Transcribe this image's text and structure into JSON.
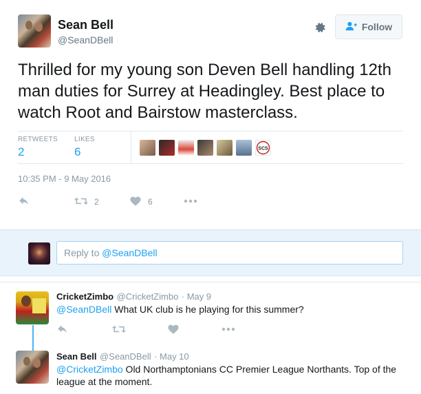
{
  "tweet": {
    "author_name": "Sean Bell",
    "author_handle": "@SeanDBell",
    "follow_label": "Follow",
    "text": "Thrilled for my young son Deven Bell handling 12th man duties for Surrey at Headingley. Best place to watch Root and Bairstow masterclass.",
    "retweets_label": "RETWEETS",
    "retweets_count": "2",
    "likes_label": "LIKES",
    "likes_count": "6",
    "timestamp": "10:35 PM - 9 May 2016",
    "action_retweet_count": "2",
    "action_like_count": "6",
    "likers": [
      {
        "name": "liker-1",
        "color": "#a07a6a"
      },
      {
        "name": "liker-2",
        "color": "#8a2a2a"
      },
      {
        "name": "liker-3",
        "color": "#c8463a"
      },
      {
        "name": "liker-4",
        "color": "#5a4a3a"
      },
      {
        "name": "liker-5",
        "color": "#b89a6a"
      },
      {
        "name": "liker-6",
        "color": "#7a90a8"
      },
      {
        "name": "liker-7",
        "color": "#f0f0f0"
      }
    ]
  },
  "reply_box": {
    "prefix": "Reply to ",
    "mention": "@SeanDBell"
  },
  "replies": [
    {
      "name": "CricketZimbo",
      "handle": "@CricketZimbo",
      "date": "· May 9",
      "mention": "@SeanDBell",
      "text": " What UK club is he playing for this summer?"
    },
    {
      "name": "Sean Bell",
      "handle": "@SeanDBell",
      "date": "· May 10",
      "mention": "@CricketZimbo",
      "text": " Old Northamptonians CC Premier League Northants. Top of the league at the moment."
    }
  ],
  "colors": {
    "accent": "#1da1f2",
    "muted": "#8899a6",
    "reply_bg": "#e8f3fb"
  }
}
